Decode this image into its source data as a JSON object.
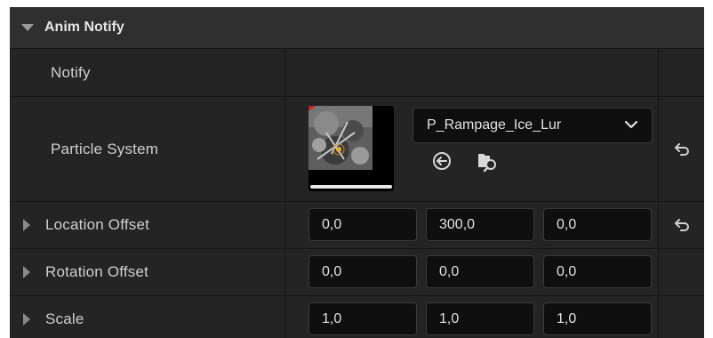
{
  "section": {
    "title": "Anim Notify"
  },
  "rows": {
    "notify": {
      "label": "Notify"
    },
    "particle_system": {
      "label": "Particle System",
      "asset_name": "P_Rampage_Ice_Lur",
      "icons": [
        "dropdown-chevron-icon",
        "use-selected-asset-icon",
        "browse-to-asset-icon",
        "reset-to-default-icon"
      ]
    },
    "location_offset": {
      "label": "Location Offset",
      "x": "0,0",
      "y": "300,0",
      "z": "0,0"
    },
    "rotation_offset": {
      "label": "Rotation Offset",
      "x": "0,0",
      "y": "0,0",
      "z": "0,0"
    },
    "scale": {
      "label": "Scale",
      "x": "1,0",
      "y": "1,0",
      "z": "1,0"
    }
  },
  "colors": {
    "panel_bg": "#242424",
    "header_bg": "#2f2f2f",
    "field_bg": "#0f0f0f",
    "text": "#d6d6d6"
  }
}
